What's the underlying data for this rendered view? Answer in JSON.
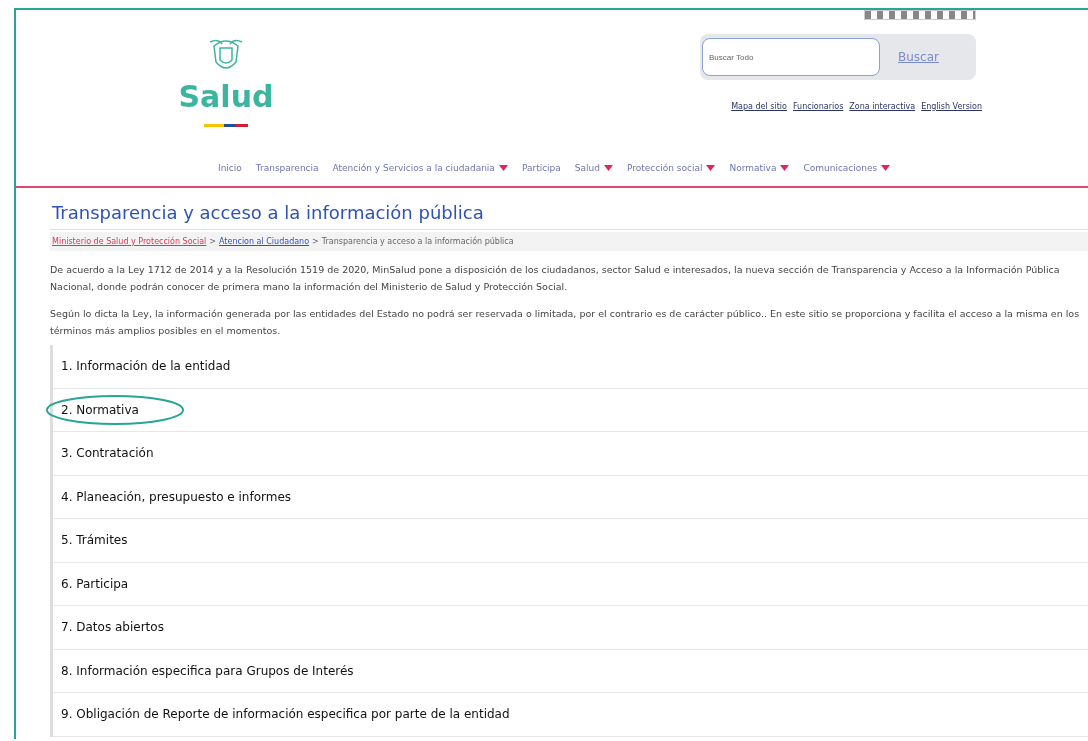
{
  "header": {
    "logo_text": "Salud",
    "search": {
      "placeholder": "Buscar Todo",
      "button": "Buscar"
    },
    "utility_links": [
      "Mapa del sitio",
      "Funcionarios",
      "Zona interactiva",
      "English Version"
    ]
  },
  "nav": [
    {
      "label": "Inicio",
      "dropdown": false
    },
    {
      "label": "Transparencia",
      "dropdown": false
    },
    {
      "label": "Atención y Servicios a la ciudadania",
      "dropdown": true
    },
    {
      "label": "Participa",
      "dropdown": false
    },
    {
      "label": "Salud",
      "dropdown": true
    },
    {
      "label": "Protección social",
      "dropdown": true
    },
    {
      "label": "Normativa",
      "dropdown": true
    },
    {
      "label": "Comunicaciones",
      "dropdown": true
    }
  ],
  "page": {
    "title": "Transparencia y acceso a la información pública",
    "breadcrumb": [
      {
        "label": "Ministerio de Salud y Protección Social",
        "kind": "link-red"
      },
      {
        "label": "Atencion al Ciudadano",
        "kind": "link-blue"
      },
      {
        "label": "Transparencia y acceso a la información pública",
        "kind": "current"
      }
    ],
    "separator": ">",
    "paragraphs": [
      "De acuerdo a la Ley 1712 de 2014 y a la Resolución 1519 de 2020, MinSalud pone a disposición de los ciudadanos, sector Salud e interesados, la nueva sección de Transparencia y Acceso a la Información Pública Nacional, donde podrán conocer de primera mano la información del Ministerio de Salud y Protección Social.",
      "Según lo dicta la Ley, la información generada por las entidades del Estado no podrá ser reservada o limitada, por el contrario es de carácter público.. En este sitio se proporciona y facilita el acceso a la misma en los términos más amplios posibles en el momentos."
    ],
    "sections": [
      {
        "label": "1. Información de la entidad",
        "highlighted": false
      },
      {
        "label": "2. Normativa",
        "highlighted": true
      },
      {
        "label": "3. Contratación",
        "highlighted": false
      },
      {
        "label": "4. Planeación, presupuesto e informes",
        "highlighted": false
      },
      {
        "label": "5. Trámites",
        "highlighted": false
      },
      {
        "label": "6. Participa",
        "highlighted": false
      },
      {
        "label": "7. Datos abiertos",
        "highlighted": false
      },
      {
        "label": "8. Información especifica para Grupos de Interés",
        "highlighted": false
      },
      {
        "label": "9. Obligación de Reporte de información especifica por parte de la entidad",
        "highlighted": false
      }
    ]
  }
}
